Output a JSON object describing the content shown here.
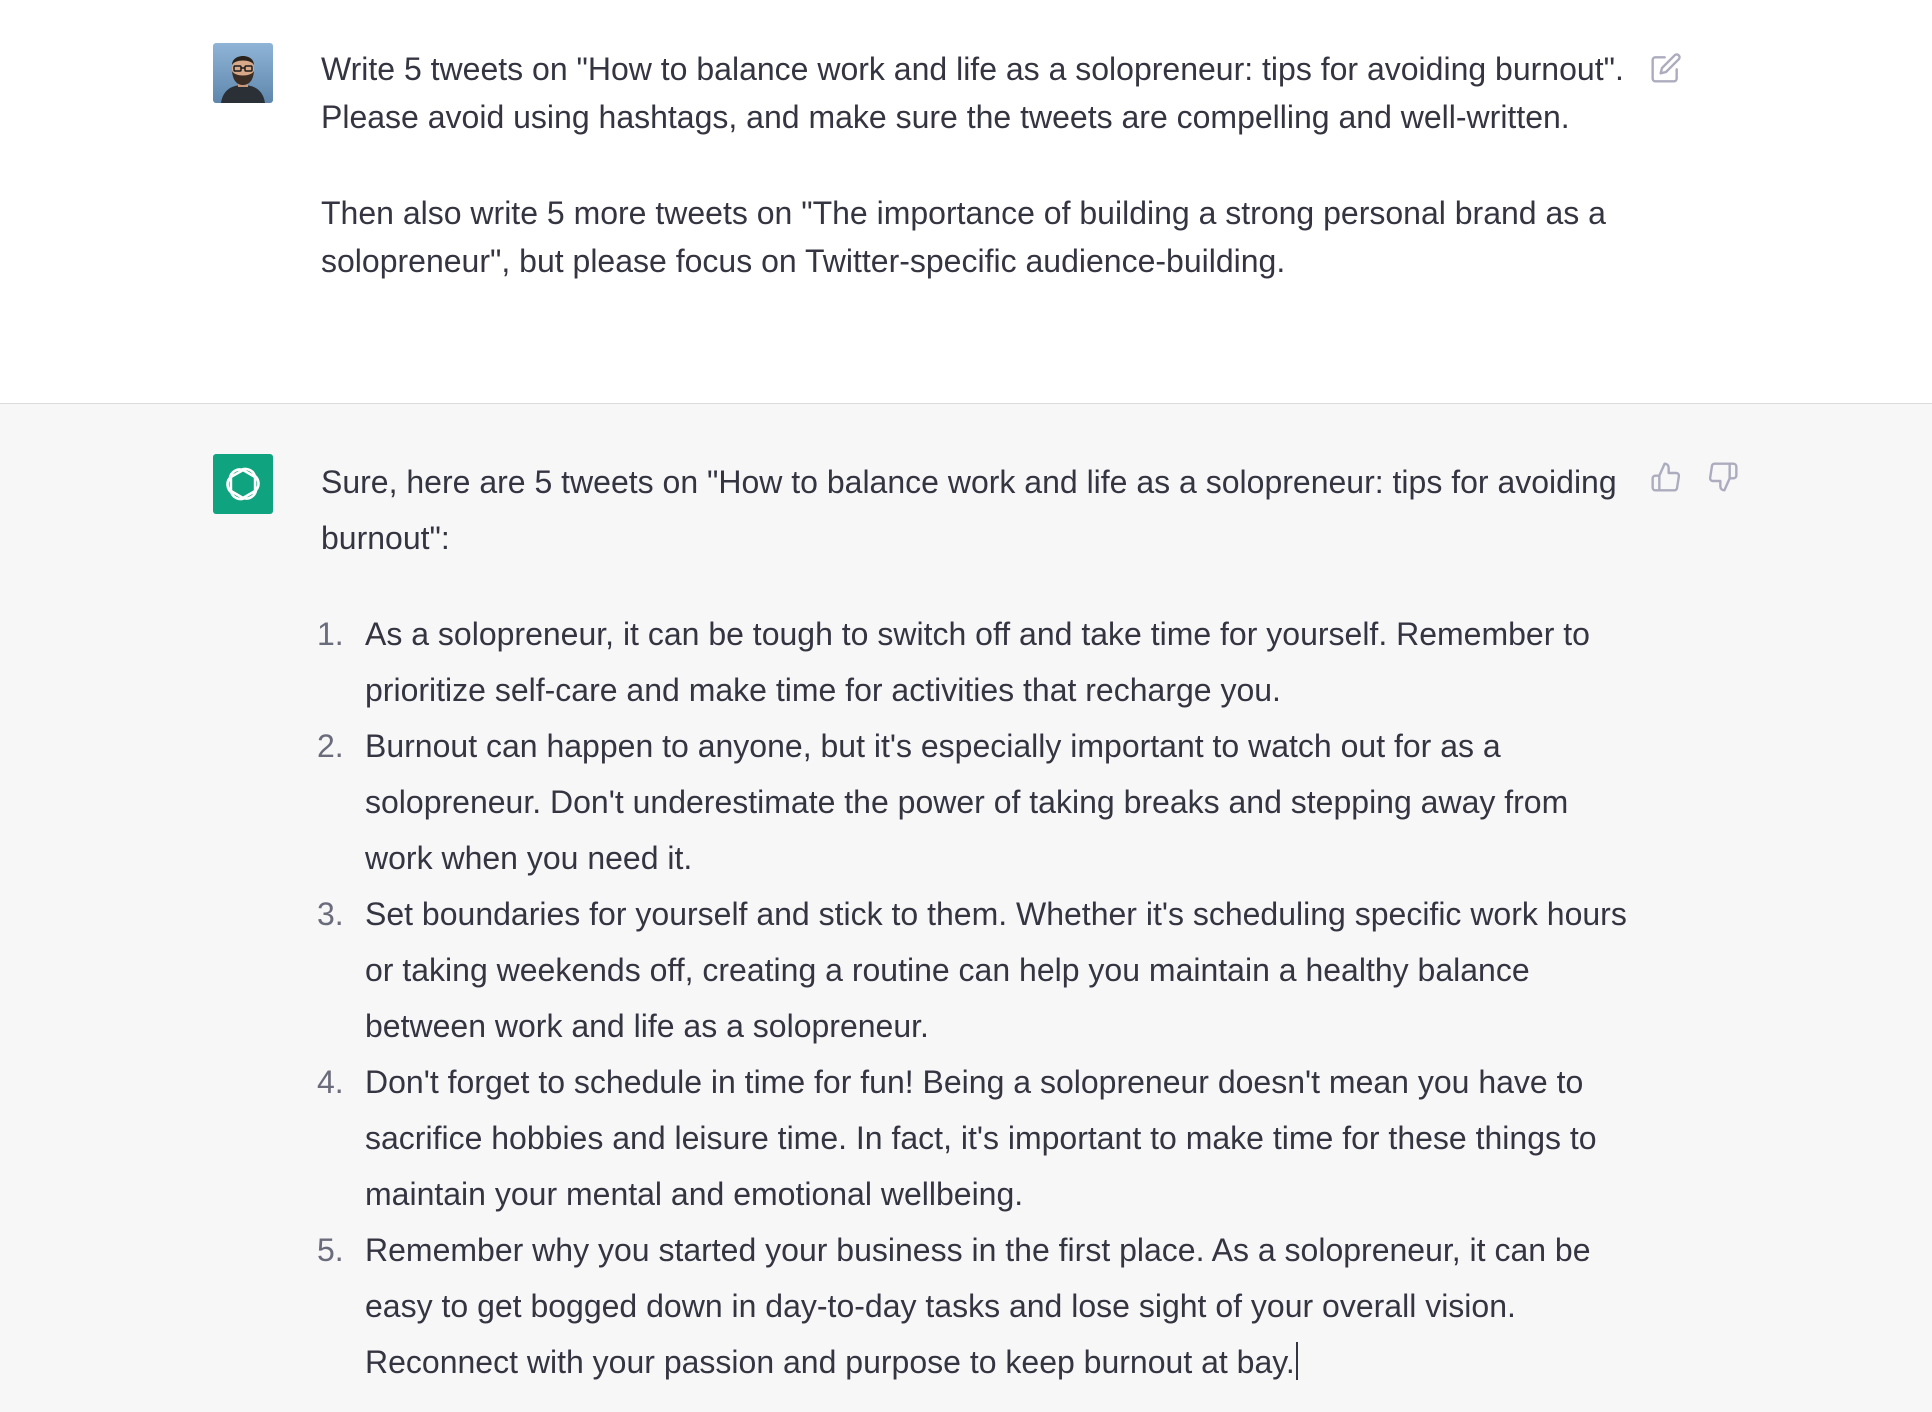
{
  "conversation": {
    "user_message": {
      "avatar_label": "User avatar",
      "paragraphs": [
        "Write 5 tweets on \"How to balance work and life as a solopreneur: tips for avoiding burnout\". Please avoid using hashtags, and make sure the tweets are compelling and well-written.",
        "Then also write 5 more tweets on \"The importance of building a strong personal brand as a solopreneur\", but please focus on Twitter-specific audience-building."
      ],
      "edit_icon": "edit-icon"
    },
    "assistant_message": {
      "avatar_icon": "openai-logo-icon",
      "intro": "Sure, here are 5 tweets on \"How to balance work and life as a solopreneur: tips for avoiding burnout\":",
      "items": [
        {
          "num": "1.",
          "text": "As a solopreneur, it can be tough to switch off and take time for yourself. Remember to prioritize self-care and make time for activities that recharge you."
        },
        {
          "num": "2.",
          "text": "Burnout can happen to anyone, but it's especially important to watch out for as a solopreneur. Don't underestimate the power of taking breaks and stepping away from work when you need it."
        },
        {
          "num": "3.",
          "text": "Set boundaries for yourself and stick to them. Whether it's scheduling specific work hours or taking weekends off, creating a routine can help you maintain a healthy balance between work and life as a solopreneur."
        },
        {
          "num": "4.",
          "text": "Don't forget to schedule in time for fun! Being a solopreneur doesn't mean you have to sacrifice hobbies and leisure time. In fact, it's important to make time for these things to maintain your mental and emotional wellbeing."
        },
        {
          "num": "5.",
          "text": "Remember why you started your business in the first place. As a solopreneur, it can be easy to get bogged down in day-to-day tasks and lose sight of your overall vision. Reconnect with your passion and purpose to keep burnout at bay."
        }
      ],
      "thumbs_up_icon": "thumbs-up-icon",
      "thumbs_down_icon": "thumbs-down-icon"
    }
  },
  "colors": {
    "user_bg": "#ffffff",
    "assistant_bg": "#f7f7f8",
    "text": "#343541",
    "muted": "#acacbe",
    "openai_green": "#10a37f"
  }
}
